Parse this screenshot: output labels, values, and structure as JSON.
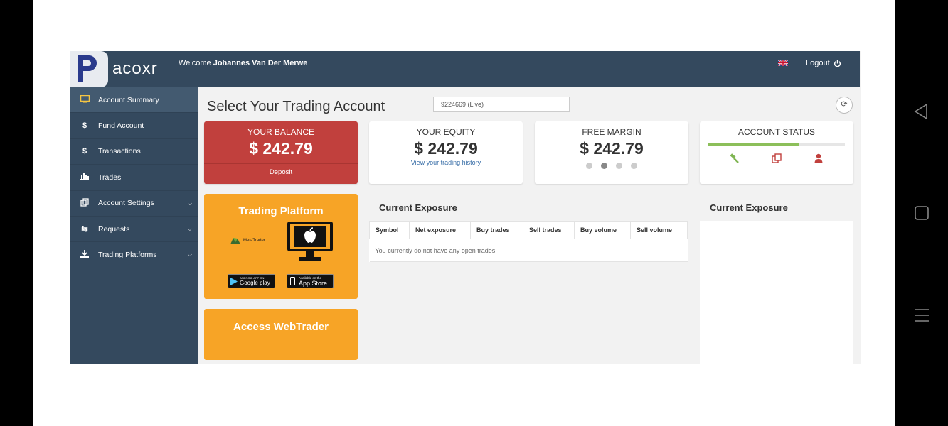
{
  "header": {
    "logo_text": "acoxr",
    "welcome_prefix": "Welcome",
    "user_name": "Johannes Van Der Merwe",
    "logout_label": "Logout"
  },
  "sidebar": {
    "items": [
      {
        "label": "Account Summary",
        "icon": "monitor-icon",
        "active": true
      },
      {
        "label": "Fund Account",
        "icon": "dollar-icon"
      },
      {
        "label": "Transactions",
        "icon": "dollar-icon"
      },
      {
        "label": "Trades",
        "icon": "bar-chart-icon"
      },
      {
        "label": "Account Settings",
        "icon": "copy-icon",
        "expandable": true
      },
      {
        "label": "Requests",
        "icon": "exchange-icon",
        "expandable": true
      },
      {
        "label": "Trading Platforms",
        "icon": "download-icon",
        "expandable": true
      }
    ]
  },
  "main": {
    "title": "Select Your Trading Account",
    "account_select": "9224669 (Live)",
    "balance": {
      "label": "YOUR BALANCE",
      "amount": "$ 242.79",
      "deposit_label": "Deposit"
    },
    "equity": {
      "label": "YOUR EQUITY",
      "amount": "$ 242.79",
      "link": "View your trading history"
    },
    "free_margin": {
      "label": "FREE MARGIN",
      "amount": "$ 242.79",
      "carousel_active_index": 1
    },
    "account_status": {
      "label": "ACCOUNT STATUS",
      "progress_fraction": 0.66
    },
    "trading_platform": {
      "title": "Trading Platform",
      "metatrader_label": "MetaTrader",
      "google_play_top": "ANDROID APP ON",
      "google_play_label": "Google play",
      "app_store_top": "Available on the",
      "app_store_label": "App Store"
    },
    "webtrader": {
      "title": "Access WebTrader"
    },
    "exposure": {
      "title": "Current Exposure",
      "columns": [
        "Symbol",
        "Net exposure",
        "Buy trades",
        "Sell trades",
        "Buy volume",
        "Sell volume"
      ],
      "empty_message": "You currently do not have any open trades"
    },
    "exposure_side": {
      "title": "Current Exposure"
    }
  },
  "colors": {
    "sidebar_bg": "#34495e",
    "balance_red": "#c1403d",
    "orange": "#f7a426",
    "status_green": "#8cbf5a"
  }
}
